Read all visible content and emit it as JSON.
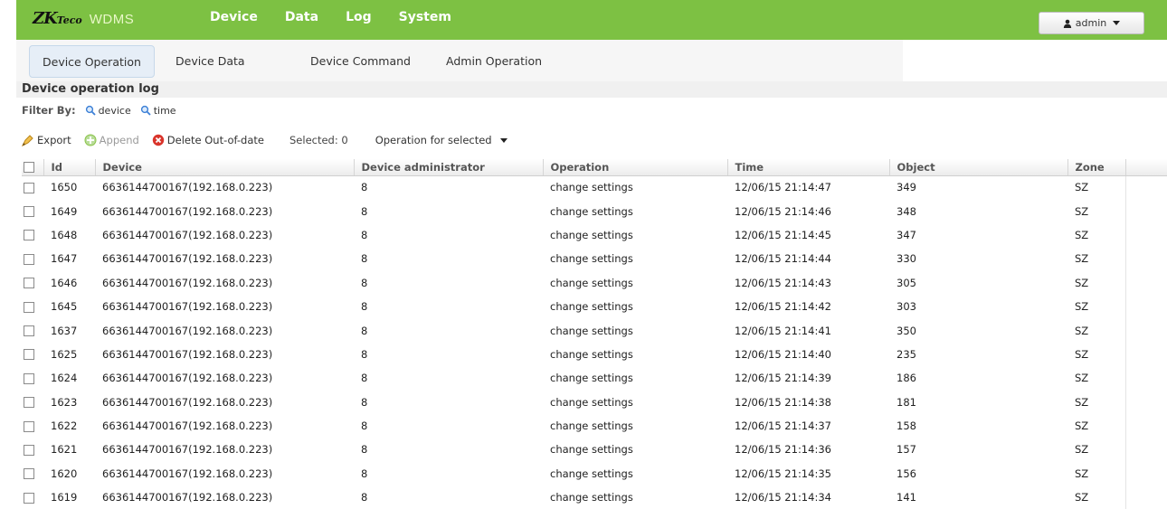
{
  "brand": {
    "logo_main": "ZK",
    "logo_sub": "Teco",
    "app_name": "WDMS"
  },
  "main_nav": [
    "Device",
    "Data",
    "Log",
    "System"
  ],
  "user": {
    "name": "admin"
  },
  "sub_tabs": [
    "Device Operation",
    "Device Data",
    "Device Command",
    "Admin Operation"
  ],
  "panel": {
    "title": "Device operation log",
    "filter_label": "Filter By:",
    "filters": [
      "device",
      "time"
    ]
  },
  "toolbar": {
    "export": "Export",
    "append": "Append",
    "delete": "Delete Out-of-date",
    "selected": "Selected: 0",
    "operation": "Operation for selected"
  },
  "table": {
    "columns": [
      "Id",
      "Device",
      "Device administrator",
      "Operation",
      "Time",
      "Object",
      "Zone"
    ],
    "rows": [
      [
        "1650",
        "6636144700167(192.168.0.223)",
        "8",
        "change settings",
        "12/06/15 21:14:47",
        "349",
        "SZ"
      ],
      [
        "1649",
        "6636144700167(192.168.0.223)",
        "8",
        "change settings",
        "12/06/15 21:14:46",
        "348",
        "SZ"
      ],
      [
        "1648",
        "6636144700167(192.168.0.223)",
        "8",
        "change settings",
        "12/06/15 21:14:45",
        "347",
        "SZ"
      ],
      [
        "1647",
        "6636144700167(192.168.0.223)",
        "8",
        "change settings",
        "12/06/15 21:14:44",
        "330",
        "SZ"
      ],
      [
        "1646",
        "6636144700167(192.168.0.223)",
        "8",
        "change settings",
        "12/06/15 21:14:43",
        "305",
        "SZ"
      ],
      [
        "1645",
        "6636144700167(192.168.0.223)",
        "8",
        "change settings",
        "12/06/15 21:14:42",
        "303",
        "SZ"
      ],
      [
        "1637",
        "6636144700167(192.168.0.223)",
        "8",
        "change settings",
        "12/06/15 21:14:41",
        "350",
        "SZ"
      ],
      [
        "1625",
        "6636144700167(192.168.0.223)",
        "8",
        "change settings",
        "12/06/15 21:14:40",
        "235",
        "SZ"
      ],
      [
        "1624",
        "6636144700167(192.168.0.223)",
        "8",
        "change settings",
        "12/06/15 21:14:39",
        "186",
        "SZ"
      ],
      [
        "1623",
        "6636144700167(192.168.0.223)",
        "8",
        "change settings",
        "12/06/15 21:14:38",
        "181",
        "SZ"
      ],
      [
        "1622",
        "6636144700167(192.168.0.223)",
        "8",
        "change settings",
        "12/06/15 21:14:37",
        "158",
        "SZ"
      ],
      [
        "1621",
        "6636144700167(192.168.0.223)",
        "8",
        "change settings",
        "12/06/15 21:14:36",
        "157",
        "SZ"
      ],
      [
        "1620",
        "6636144700167(192.168.0.223)",
        "8",
        "change settings",
        "12/06/15 21:14:35",
        "156",
        "SZ"
      ],
      [
        "1619",
        "6636144700167(192.168.0.223)",
        "8",
        "change settings",
        "12/06/15 21:14:34",
        "141",
        "SZ"
      ]
    ]
  },
  "icons": {
    "user": "user-icon",
    "filter": "magnifier-icon",
    "export": "export-icon",
    "append": "append-icon",
    "delete": "delete-icon",
    "dropdown": "caret-down-icon"
  },
  "colors": {
    "header_green": "#7dc143",
    "delete_red": "#d9342b",
    "export_orange": "#e8a317",
    "append_green": "#8bc34a"
  }
}
